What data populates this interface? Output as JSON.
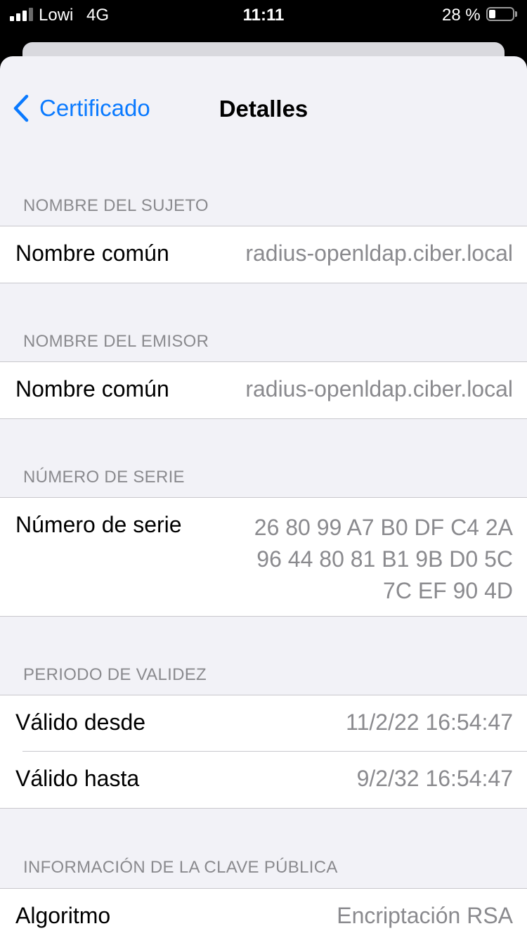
{
  "status_bar": {
    "carrier": "Lowi",
    "network": "4G",
    "time": "11:11",
    "battery_percent": "28 %"
  },
  "nav": {
    "back_label": "Certificado",
    "title": "Detalles",
    "accent_color": "#0a7aff"
  },
  "sections": [
    {
      "header": "NOMBRE DEL SUJETO",
      "rows": [
        {
          "label": "Nombre común",
          "value": "radius-openldap.ciber.local"
        }
      ]
    },
    {
      "header": "NOMBRE DEL EMISOR",
      "rows": [
        {
          "label": "Nombre común",
          "value": "radius-openldap.ciber.local"
        }
      ]
    },
    {
      "header": "NÚMERO DE SERIE",
      "rows": [
        {
          "label": "Número de serie",
          "value_lines": [
            "26 80 99 A7 B0 DF C4 2A",
            "96 44 80 81 B1 9B D0 5C",
            "7C EF 90 4D"
          ]
        }
      ]
    },
    {
      "header": "PERIODO DE VALIDEZ",
      "rows": [
        {
          "label": "Válido desde",
          "value": "11/2/22 16:54:47"
        },
        {
          "label": "Válido hasta",
          "value": "9/2/32 16:54:47"
        }
      ]
    },
    {
      "header": "INFORMACIÓN DE LA CLAVE PÚBLICA",
      "rows": [
        {
          "label": "Algoritmo",
          "value": "Encriptación RSA"
        }
      ]
    }
  ]
}
